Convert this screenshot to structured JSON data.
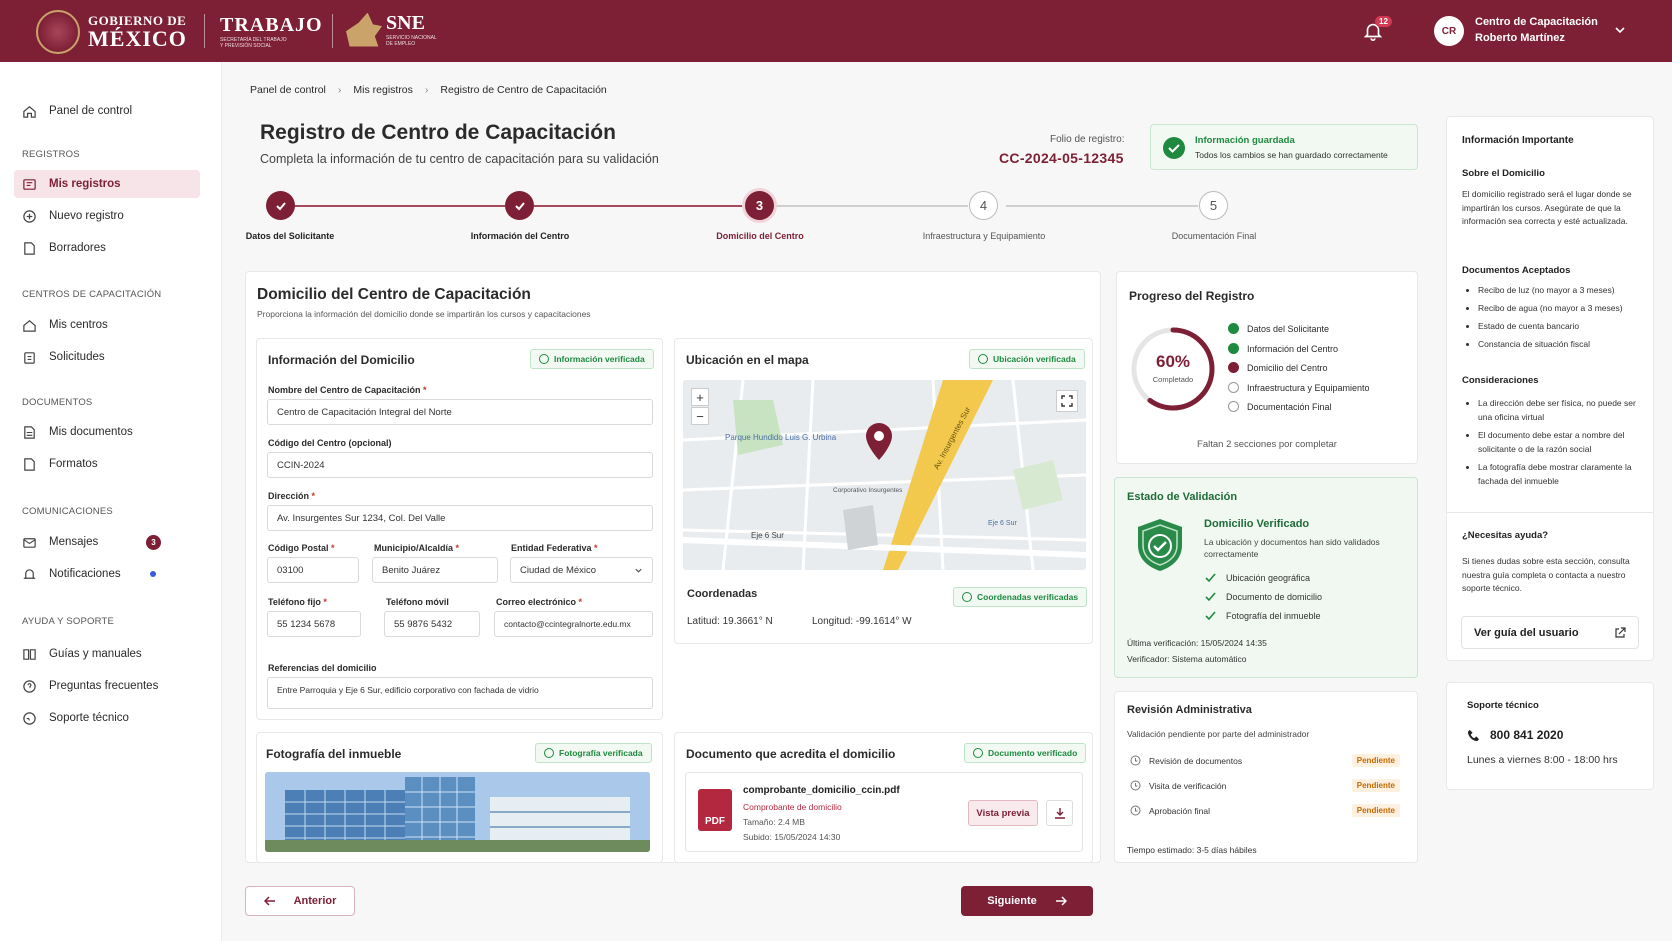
{
  "header": {
    "gob_line1": "GOBIERNO DE",
    "gob_line2": "MÉXICO",
    "trabajo": "TRABAJO",
    "trabajo_sub": "SECRETARÍA DEL TRABAJO Y PREVISIÓN SOCIAL",
    "sne": "SNE",
    "sne_sub": "SERVICIO NACIONAL DE EMPLEO",
    "notifications_count": "12",
    "avatar_initials": "CR",
    "user_line1": "Centro de Capacitación",
    "user_line2": "Roberto Martínez"
  },
  "sidebar": {
    "panel": "Panel de control",
    "sec_registros": "REGISTROS",
    "mis_registros": "Mis registros",
    "nuevo_registro": "Nuevo registro",
    "borradores": "Borradores",
    "sec_centros": "CENTROS DE CAPACITACIÓN",
    "mis_centros": "Mis centros",
    "solicitudes": "Solicitudes",
    "sec_documentos": "DOCUMENTOS",
    "mis_documentos": "Mis documentos",
    "formatos": "Formatos",
    "sec_comunicaciones": "COMUNICACIONES",
    "mensajes": "Mensajes",
    "mensajes_count": "3",
    "notificaciones": "Notificaciones",
    "sec_ayuda": "AYUDA Y SOPORTE",
    "guias": "Guías y manuales",
    "preguntas": "Preguntas frecuentes",
    "soporte": "Soporte técnico"
  },
  "breadcrumb": [
    "Panel de control",
    "Mis registros",
    "Registro de Centro de Capacitación"
  ],
  "page": {
    "title": "Registro de Centro de Capacitación",
    "subtitle": "Completa la información de tu centro de capacitación para su validación",
    "folio_label": "Folio de registro:",
    "folio_value": "CC-2024-05-12345",
    "saved_title": "Información guardada",
    "saved_text": "Todos los cambios se han guardado correctamente"
  },
  "steps": [
    {
      "num": "1",
      "label": "Datos del Solicitante"
    },
    {
      "num": "2",
      "label": "Información del Centro"
    },
    {
      "num": "3",
      "label": "Domicilio del Centro"
    },
    {
      "num": "4",
      "label": "Infraestructura y Equipamiento"
    },
    {
      "num": "5",
      "label": "Documentación Final"
    }
  ],
  "main": {
    "title": "Domicilio del Centro de Capacitación",
    "subtitle": "Proporciona la información del domicilio donde se impartirán los cursos y capacitaciones",
    "info_title": "Información del Domicilio",
    "info_badge": "Información verificada",
    "f_nombre_label": "Nombre del Centro de Capacitación",
    "f_nombre": "Centro de Capacitación Integral del Norte",
    "f_codigo_label": "Código del Centro (opcional)",
    "f_codigo": "CCIN-2024",
    "f_direccion_label": "Dirección",
    "f_direccion": "Av. Insurgentes Sur 1234, Col. Del Valle",
    "f_cp_label": "Código Postal",
    "f_cp": "03100",
    "f_mun_label": "Municipio/Alcaldía",
    "f_mun": "Benito Juárez",
    "f_ent_label": "Entidad Federativa",
    "f_ent": "Ciudad de México",
    "f_tel_label": "Teléfono fijo",
    "f_tel": "55 1234 5678",
    "f_cel_label": "Teléfono móvil",
    "f_cel": "55 9876 5432",
    "f_mail_label": "Correo electrónico",
    "f_mail": "contacto@ccintegralnorte.edu.mx",
    "f_ref_label": "Referencias del domicilio",
    "f_ref": "Entre Parroquia y Eje 6 Sur, edificio corporativo con fachada de vidrio",
    "map_title": "Ubicación en el mapa",
    "map_badge": "Ubicación verificada",
    "map_labels": {
      "park": "Parque Hundido Luis G. Urbina",
      "avenue": "Av. Insurgentes Sur",
      "street": "Eje 6 Sur",
      "building": "Corporativo Insurgentes",
      "transit": "Eje 6 Sur"
    },
    "coords_title": "Coordenadas",
    "coords_badge": "Coordenadas verificadas",
    "lat": "Latitud: 19.3661° N",
    "lon": "Longitud: -99.1614° W",
    "photo_title": "Fotografía del inmueble",
    "photo_badge": "Fotografía verificada",
    "doc_title": "Documento que acredita el domicilio",
    "doc_badge": "Documento verificado",
    "doc_name": "comprobante_domicilio_ccin.pdf",
    "doc_type": "Comprobante de domicilio",
    "doc_size": "Tamaño: 2.4 MB",
    "doc_date": "Subido: 15/05/2024 14:30",
    "doc_preview": "Vista previa",
    "pdf_label": "PDF"
  },
  "progress": {
    "title": "Progreso del Registro",
    "percent": "60%",
    "percent_value": 60,
    "percent_label": "Completado",
    "items": [
      "Datos del Solicitante",
      "Información del Centro",
      "Domicilio del Centro",
      "Infraestructura y Equipamiento",
      "Documentación Final"
    ],
    "footer": "Faltan 2 secciones por completar"
  },
  "validation": {
    "title": "Estado de Validación",
    "status": "Domicilio Verificado",
    "desc": "La ubicación y documentos han sido validados correctamente",
    "checks": [
      "Ubicación geográfica",
      "Documento de domicilio",
      "Fotografía del inmueble"
    ],
    "last": "Última verificación: 15/05/2024 14:35",
    "verifier": "Verificador: Sistema automático"
  },
  "review": {
    "title": "Revisión Administrativa",
    "subtitle": "Validación pendiente por parte del administrador",
    "items": [
      "Revisión de documentos",
      "Visita de verificación",
      "Aprobación final"
    ],
    "status": "Pendiente",
    "estimate": "Tiempo estimado: 3-5 días hábiles"
  },
  "info": {
    "title": "Información Importante",
    "dom_title": "Sobre el Domicilio",
    "dom_text": "El domicilio registrado será el lugar donde se impartirán los cursos. Asegúrate de que la información sea correcta y esté actualizada.",
    "docs_title": "Documentos Aceptados",
    "docs": [
      "Recibo de luz (no mayor a 3 meses)",
      "Recibo de agua (no mayor a 3 meses)",
      "Estado de cuenta bancario",
      "Constancia de situación fiscal"
    ],
    "cons_title": "Consideraciones",
    "cons": [
      "La dirección debe ser física, no puede ser una oficina virtual",
      "El documento debe estar a nombre del solicitante o de la razón social",
      "La fotografía debe mostrar claramente la fachada del inmueble"
    ],
    "help_title": "¿Necesitas ayuda?",
    "help_text": "Si tienes dudas sobre esta sección, consulta nuestra guía completa o contacta a nuestro soporte técnico.",
    "guide_btn": "Ver guía del usuario"
  },
  "support": {
    "title": "Soporte técnico",
    "phone": "800 841 2020",
    "hours": "Lunes a viernes 8:00 - 18:00 hrs"
  },
  "nav": {
    "prev": "Anterior",
    "next": "Siguiente"
  }
}
